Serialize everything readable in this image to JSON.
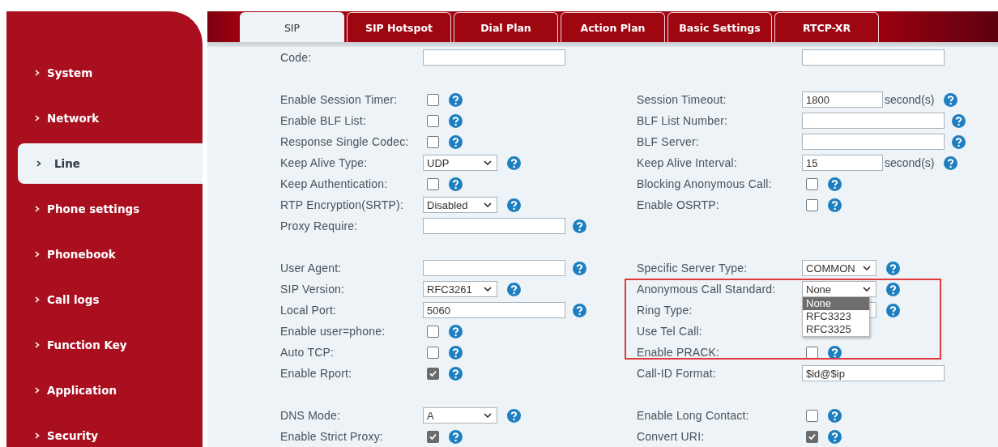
{
  "sidebar": {
    "items": [
      {
        "label": "System",
        "selected": false
      },
      {
        "label": "Network",
        "selected": false
      },
      {
        "label": "Line",
        "selected": true
      },
      {
        "label": "Phone settings",
        "selected": false
      },
      {
        "label": "Phonebook",
        "selected": false
      },
      {
        "label": "Call logs",
        "selected": false
      },
      {
        "label": "Function Key",
        "selected": false
      },
      {
        "label": "Application",
        "selected": false
      },
      {
        "label": "Security",
        "selected": false
      }
    ]
  },
  "tabs": [
    {
      "label": "SIP",
      "selected": true
    },
    {
      "label": "SIP Hotspot",
      "selected": false
    },
    {
      "label": "Dial Plan",
      "selected": false
    },
    {
      "label": "Action Plan",
      "selected": false
    },
    {
      "label": "Basic Settings",
      "selected": false
    },
    {
      "label": "RTCP-XR",
      "selected": false
    }
  ],
  "form": {
    "sections": [
      [
        {
          "left": {
            "label": "Code:",
            "kind": "text"
          },
          "right": {
            "kind": "text"
          }
        }
      ],
      [
        {
          "left": {
            "label": "Enable Session Timer:",
            "kind": "checkbox",
            "checked": false,
            "help": true
          },
          "right": {
            "label": "Session Timeout:",
            "kind": "text",
            "value": "1800",
            "unit": "second(s)",
            "help": true
          }
        },
        {
          "left": {
            "label": "Enable BLF List:",
            "kind": "checkbox",
            "checked": false,
            "help": true
          },
          "right": {
            "label": "BLF List Number:",
            "kind": "text",
            "help": true
          }
        },
        {
          "left": {
            "label": "Response Single Codec:",
            "kind": "checkbox",
            "checked": false,
            "help": true
          },
          "right": {
            "label": "BLF Server:",
            "kind": "text",
            "help": true
          }
        },
        {
          "left": {
            "label": "Keep Alive Type:",
            "kind": "select",
            "value": "UDP",
            "help": true
          },
          "right": {
            "label": "Keep Alive Interval:",
            "kind": "text",
            "value": "15",
            "unit": "second(s)",
            "help": true
          }
        },
        {
          "left": {
            "label": "Keep Authentication:",
            "kind": "checkbox",
            "checked": false,
            "help": true
          },
          "right": {
            "label": "Blocking Anonymous Call:",
            "kind": "checkbox",
            "checked": false,
            "help": true
          }
        },
        {
          "left": {
            "label": "RTP Encryption(SRTP):",
            "kind": "select",
            "value": "Disabled",
            "help": true
          },
          "right": {
            "label": "Enable OSRTP:",
            "kind": "checkbox",
            "checked": false,
            "help": true
          }
        },
        {
          "left": {
            "label": "Proxy Require:",
            "kind": "text",
            "help": true
          }
        }
      ],
      [
        {
          "left": {
            "label": "User Agent:",
            "kind": "text",
            "help": true
          },
          "right": {
            "label": "Specific Server Type:",
            "kind": "select",
            "value": "COMMON",
            "help": true
          }
        },
        {
          "left": {
            "label": "SIP Version:",
            "kind": "select",
            "value": "RFC3261",
            "help": true
          },
          "right": {
            "label": "Anonymous Call Standard:",
            "kind": "select",
            "value": "None",
            "help": true,
            "highlighted": true,
            "open": true,
            "options": [
              {
                "label": "None",
                "selected": true
              },
              {
                "label": "RFC3323",
                "selected": false
              },
              {
                "label": "RFC3325",
                "selected": false
              }
            ]
          }
        },
        {
          "left": {
            "label": "Local Port:",
            "kind": "text",
            "value": "5060",
            "help": true
          },
          "right": {
            "label": "Ring Type:",
            "kind": "select",
            "help": true,
            "highlighted": true
          }
        },
        {
          "left": {
            "label": "Enable user=phone:",
            "kind": "checkbox",
            "checked": false,
            "help": true
          },
          "right": {
            "label": "Use Tel Call:",
            "kind": "none",
            "highlighted": true
          }
        },
        {
          "left": {
            "label": "Auto TCP:",
            "kind": "checkbox",
            "checked": false,
            "help": true
          },
          "right": {
            "label": "Enable PRACK:",
            "kind": "checkbox",
            "checked": false,
            "help": true,
            "highlighted": true
          }
        },
        {
          "left": {
            "label": "Enable Rport:",
            "kind": "checkbox",
            "checked": true,
            "help": true
          },
          "right": {
            "label": "Call-ID Format:",
            "kind": "text",
            "value": "$id@$ip"
          }
        }
      ],
      [
        {
          "left": {
            "label": "DNS Mode:",
            "kind": "select",
            "value": "A",
            "help": true
          },
          "right": {
            "label": "Enable Long Contact:",
            "kind": "checkbox",
            "checked": false,
            "help": true
          }
        },
        {
          "left": {
            "label": "Enable Strict Proxy:",
            "kind": "checkbox",
            "checked": true,
            "help": true
          },
          "right": {
            "label": "Convert URI:",
            "kind": "checkbox",
            "checked": true,
            "help": true
          }
        }
      ]
    ]
  }
}
